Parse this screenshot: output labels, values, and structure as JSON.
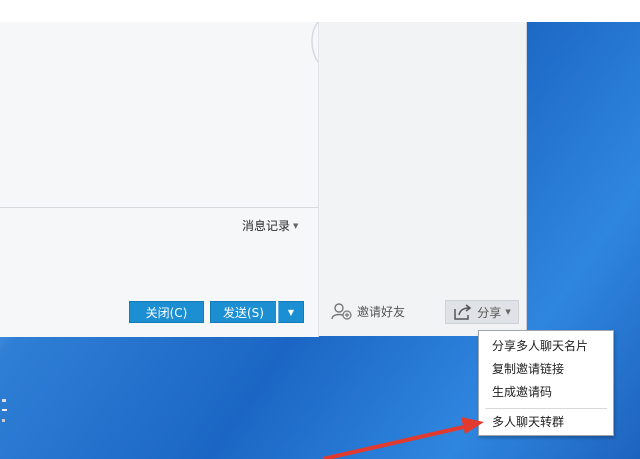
{
  "chat": {
    "history_label": "消息记录",
    "close_label": "关闭(C)",
    "send_label": "发送(S)"
  },
  "side": {
    "invite_label": "邀请好友",
    "share_label": "分享"
  },
  "share_menu": {
    "items": [
      "分享多人聊天名片",
      "复制邀请链接",
      "生成邀请码",
      "多人聊天转群"
    ]
  },
  "colors": {
    "accent": "#1c8fd3",
    "annotation_arrow": "#e23a2e"
  }
}
